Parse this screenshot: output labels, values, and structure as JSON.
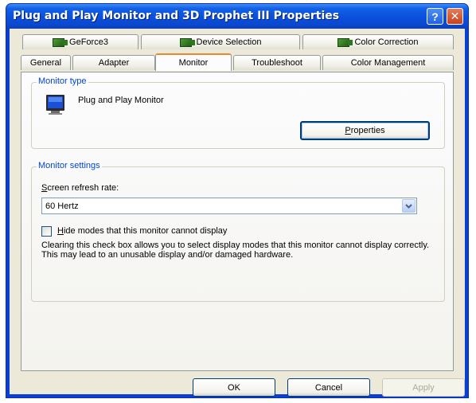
{
  "window": {
    "title": "Plug and Play Monitor and 3D Prophet III Properties",
    "help_glyph": "?",
    "close_glyph": "✕"
  },
  "tabs": {
    "row1": [
      {
        "label": "GeForce3",
        "icon": "nvidia-icon"
      },
      {
        "label": "Device Selection",
        "icon": "nvidia-icon"
      },
      {
        "label": "Color Correction",
        "icon": "nvidia-icon"
      }
    ],
    "row2": [
      {
        "label": "General"
      },
      {
        "label": "Adapter"
      },
      {
        "label": "Monitor",
        "active": true
      },
      {
        "label": "Troubleshoot"
      },
      {
        "label": "Color Management"
      }
    ]
  },
  "monitor_type": {
    "group_title": "Monitor type",
    "monitor_name": "Plug and Play Monitor",
    "properties_label": "Properties",
    "properties_mnemonic": "P",
    "properties_rest": "roperties"
  },
  "monitor_settings": {
    "group_title": "Monitor settings",
    "refresh_label_mnemonic": "S",
    "refresh_label_rest": "creen refresh rate:",
    "refresh_value": "60 Hertz",
    "hide_modes_mnemonic": "H",
    "hide_modes_rest": "ide modes that this monitor cannot display",
    "hide_modes_checked": false,
    "description": "Clearing this check box allows you to select display modes that this monitor cannot display correctly. This may lead to an unusable display and/or damaged hardware."
  },
  "buttons": {
    "ok": "OK",
    "cancel": "Cancel",
    "apply": "Apply"
  },
  "colors": {
    "titlebar": "#0a4fdc",
    "group_title": "#0046d5",
    "dialog_bg": "#ece9d8",
    "active_tab_accent": "#e68b2c"
  }
}
